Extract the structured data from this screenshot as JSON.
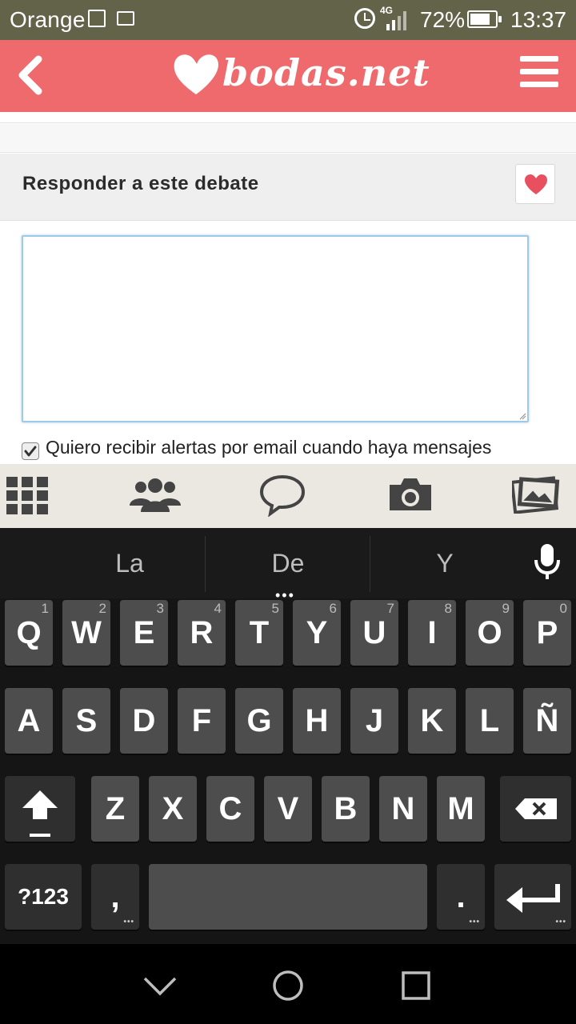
{
  "status_bar": {
    "carrier": "Orange",
    "network": "4G",
    "battery_percent": "72%",
    "battery_level": 0.72,
    "time": "13:37"
  },
  "header": {
    "logo_text": "bodas.net",
    "brand_color": "#ee6a6c",
    "back_icon": "chevron-left-icon",
    "menu_icon": "hamburger-menu-icon"
  },
  "reply": {
    "title": "Responder a este debate",
    "favorite_icon": "heart-icon",
    "message_value": "",
    "alert_checked": true,
    "alert_label": "Quiero recibir alertas por email cuando haya mensajes"
  },
  "tabbar": {
    "items": [
      {
        "icon": "grid-apps-icon"
      },
      {
        "icon": "community-people-icon"
      },
      {
        "icon": "chat-bubble-icon"
      },
      {
        "icon": "camera-icon"
      },
      {
        "icon": "photos-gallery-icon"
      }
    ]
  },
  "keyboard": {
    "suggestions": [
      "La",
      "De",
      "Y"
    ],
    "more_dots": "•••",
    "mic_icon": "microphone-icon",
    "row1": [
      {
        "label": "Q",
        "hint": "1"
      },
      {
        "label": "W",
        "hint": "2"
      },
      {
        "label": "E",
        "hint": "3"
      },
      {
        "label": "R",
        "hint": "4"
      },
      {
        "label": "T",
        "hint": "5"
      },
      {
        "label": "Y",
        "hint": "6"
      },
      {
        "label": "U",
        "hint": "7"
      },
      {
        "label": "I",
        "hint": "8"
      },
      {
        "label": "O",
        "hint": "9"
      },
      {
        "label": "P",
        "hint": "0"
      }
    ],
    "row2": [
      "A",
      "S",
      "D",
      "F",
      "G",
      "H",
      "J",
      "K",
      "L",
      "Ñ"
    ],
    "row3": [
      "Z",
      "X",
      "C",
      "V",
      "B",
      "N",
      "M"
    ],
    "shift_icon": "shift-arrow-icon",
    "backspace_icon": "backspace-icon",
    "symbols_label": "?123",
    "comma_label": ",",
    "period_label": ".",
    "enter_icon": "enter-return-icon"
  },
  "navbar": {
    "back_icon": "nav-back-triangle-icon",
    "home_icon": "nav-home-circle-icon",
    "recents_icon": "nav-recents-square-icon"
  }
}
